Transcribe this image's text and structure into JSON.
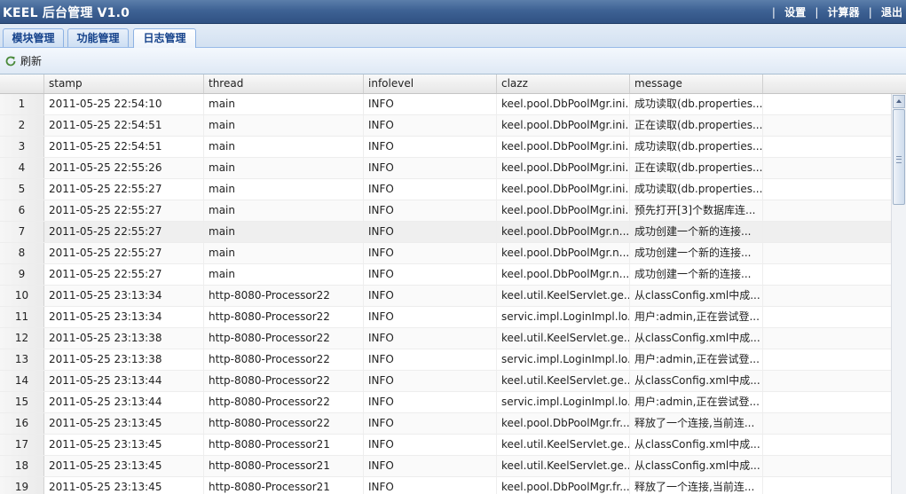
{
  "header": {
    "title": "KEEL 后台管理 V1.0",
    "links": [
      "设置",
      "计算器",
      "退出"
    ]
  },
  "tabs": [
    {
      "label": "模块管理",
      "active": false
    },
    {
      "label": "功能管理",
      "active": false
    },
    {
      "label": "日志管理",
      "active": true
    }
  ],
  "toolbar": {
    "refresh_label": "刷新",
    "refresh_icon": "refresh-icon"
  },
  "grid": {
    "columns": [
      "",
      "stamp",
      "thread",
      "infolevel",
      "clazz",
      "message"
    ],
    "selected_row": 7,
    "rows": [
      {
        "n": "1",
        "stamp": "2011-05-25 22:54:10",
        "thread": "main",
        "infolevel": "INFO",
        "clazz": "keel.pool.DbPoolMgr.ini...",
        "message": "成功读取(db.properties..."
      },
      {
        "n": "2",
        "stamp": "2011-05-25 22:54:51",
        "thread": "main",
        "infolevel": "INFO",
        "clazz": "keel.pool.DbPoolMgr.ini...",
        "message": "正在读取(db.properties..."
      },
      {
        "n": "3",
        "stamp": "2011-05-25 22:54:51",
        "thread": "main",
        "infolevel": "INFO",
        "clazz": "keel.pool.DbPoolMgr.ini...",
        "message": "成功读取(db.properties..."
      },
      {
        "n": "4",
        "stamp": "2011-05-25 22:55:26",
        "thread": "main",
        "infolevel": "INFO",
        "clazz": "keel.pool.DbPoolMgr.ini...",
        "message": "正在读取(db.properties..."
      },
      {
        "n": "5",
        "stamp": "2011-05-25 22:55:27",
        "thread": "main",
        "infolevel": "INFO",
        "clazz": "keel.pool.DbPoolMgr.ini...",
        "message": "成功读取(db.properties..."
      },
      {
        "n": "6",
        "stamp": "2011-05-25 22:55:27",
        "thread": "main",
        "infolevel": "INFO",
        "clazz": "keel.pool.DbPoolMgr.ini...",
        "message": "预先打开[3]个数据库连..."
      },
      {
        "n": "7",
        "stamp": "2011-05-25 22:55:27",
        "thread": "main",
        "infolevel": "INFO",
        "clazz": "keel.pool.DbPoolMgr.n...",
        "message": "成功创建一个新的连接..."
      },
      {
        "n": "8",
        "stamp": "2011-05-25 22:55:27",
        "thread": "main",
        "infolevel": "INFO",
        "clazz": "keel.pool.DbPoolMgr.n...",
        "message": "成功创建一个新的连接..."
      },
      {
        "n": "9",
        "stamp": "2011-05-25 22:55:27",
        "thread": "main",
        "infolevel": "INFO",
        "clazz": "keel.pool.DbPoolMgr.n...",
        "message": "成功创建一个新的连接..."
      },
      {
        "n": "10",
        "stamp": "2011-05-25 23:13:34",
        "thread": "http-8080-Processor22",
        "infolevel": "INFO",
        "clazz": "keel.util.KeelServlet.ge...",
        "message": "从classConfig.xml中成..."
      },
      {
        "n": "11",
        "stamp": "2011-05-25 23:13:34",
        "thread": "http-8080-Processor22",
        "infolevel": "INFO",
        "clazz": "servic.impl.LoginImpl.lo...",
        "message": "用户:admin,正在尝试登..."
      },
      {
        "n": "12",
        "stamp": "2011-05-25 23:13:38",
        "thread": "http-8080-Processor22",
        "infolevel": "INFO",
        "clazz": "keel.util.KeelServlet.ge...",
        "message": "从classConfig.xml中成..."
      },
      {
        "n": "13",
        "stamp": "2011-05-25 23:13:38",
        "thread": "http-8080-Processor22",
        "infolevel": "INFO",
        "clazz": "servic.impl.LoginImpl.lo...",
        "message": "用户:admin,正在尝试登..."
      },
      {
        "n": "14",
        "stamp": "2011-05-25 23:13:44",
        "thread": "http-8080-Processor22",
        "infolevel": "INFO",
        "clazz": "keel.util.KeelServlet.ge...",
        "message": "从classConfig.xml中成..."
      },
      {
        "n": "15",
        "stamp": "2011-05-25 23:13:44",
        "thread": "http-8080-Processor22",
        "infolevel": "INFO",
        "clazz": "servic.impl.LoginImpl.lo...",
        "message": "用户:admin,正在尝试登..."
      },
      {
        "n": "16",
        "stamp": "2011-05-25 23:13:45",
        "thread": "http-8080-Processor22",
        "infolevel": "INFO",
        "clazz": "keel.pool.DbPoolMgr.fr...",
        "message": "释放了一个连接,当前连..."
      },
      {
        "n": "17",
        "stamp": "2011-05-25 23:13:45",
        "thread": "http-8080-Processor21",
        "infolevel": "INFO",
        "clazz": "keel.util.KeelServlet.ge...",
        "message": "从classConfig.xml中成..."
      },
      {
        "n": "18",
        "stamp": "2011-05-25 23:13:45",
        "thread": "http-8080-Processor21",
        "infolevel": "INFO",
        "clazz": "keel.util.KeelServlet.ge...",
        "message": "从classConfig.xml中成..."
      },
      {
        "n": "19",
        "stamp": "2011-05-25 23:13:45",
        "thread": "http-8080-Processor21",
        "infolevel": "INFO",
        "clazz": "keel.pool.DbPoolMgr.fr...",
        "message": "释放了一个连接,当前连..."
      }
    ]
  },
  "colors": {
    "header_bg": "#3e6294",
    "tab_text": "#15428b",
    "selected_row": "#efefef"
  }
}
